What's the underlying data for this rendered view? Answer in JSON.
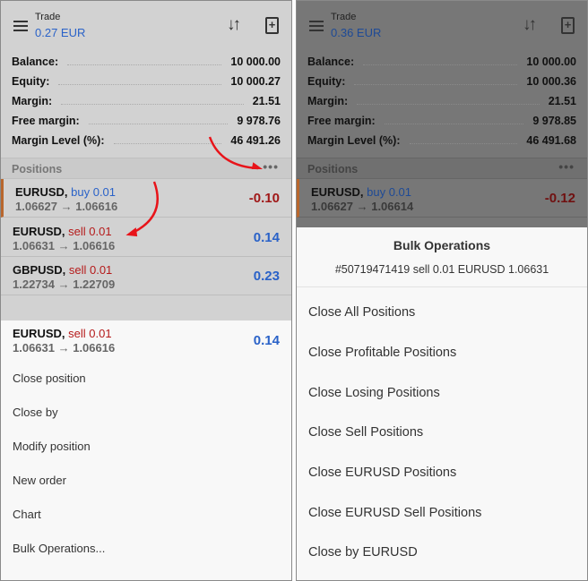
{
  "left": {
    "header": {
      "title": "Trade",
      "profit": "0.27 EUR"
    },
    "account": [
      {
        "label": "Balance:",
        "value": "10 000.00"
      },
      {
        "label": "Equity:",
        "value": "10 000.27"
      },
      {
        "label": "Margin:",
        "value": "21.51"
      },
      {
        "label": "Free margin:",
        "value": "9 978.76"
      },
      {
        "label": "Margin Level (%):",
        "value": "46 491.26"
      }
    ],
    "positions_label": "Positions",
    "more": "•••",
    "positions": [
      {
        "symbol": "EURUSD,",
        "side": "buy 0.01",
        "prices": "1.06627 → 1.06616",
        "profit": "-0.10"
      },
      {
        "symbol": "EURUSD,",
        "side": "sell 0.01",
        "prices": "1.06631 → 1.06616",
        "profit": "0.14"
      },
      {
        "symbol": "GBPUSD,",
        "side": "sell 0.01",
        "prices": "1.22734 → 1.22709",
        "profit": "0.23"
      }
    ],
    "context": {
      "symbol": "EURUSD,",
      "side": "sell 0.01",
      "prices": "1.06631 → 1.06616",
      "profit": "0.14",
      "items": [
        "Close position",
        "Close by",
        "Modify position",
        "New order",
        "Chart",
        "Bulk Operations..."
      ]
    }
  },
  "right": {
    "header": {
      "title": "Trade",
      "profit": "0.36 EUR"
    },
    "account": [
      {
        "label": "Balance:",
        "value": "10 000.00"
      },
      {
        "label": "Equity:",
        "value": "10 000.36"
      },
      {
        "label": "Margin:",
        "value": "21.51"
      },
      {
        "label": "Free margin:",
        "value": "9 978.85"
      },
      {
        "label": "Margin Level (%):",
        "value": "46 491.68"
      }
    ],
    "positions_label": "Positions",
    "more": "•••",
    "positions": [
      {
        "symbol": "EURUSD,",
        "side": "buy 0.01",
        "prices": "1.06627 → 1.06614",
        "profit": "-0.12"
      }
    ],
    "bulk": {
      "title": "Bulk Operations",
      "subtitle": "#50719471419 sell 0.01 EURUSD 1.06631",
      "items": [
        "Close All Positions",
        "Close Profitable Positions",
        "Close Losing Positions",
        "Close Sell Positions",
        "Close EURUSD Positions",
        "Close EURUSD Sell Positions",
        "Close by EURUSD"
      ]
    }
  },
  "colors": {
    "buy": "#2a62c8",
    "sell": "#b51a1a",
    "annotation_arrow": "#e8141a"
  }
}
